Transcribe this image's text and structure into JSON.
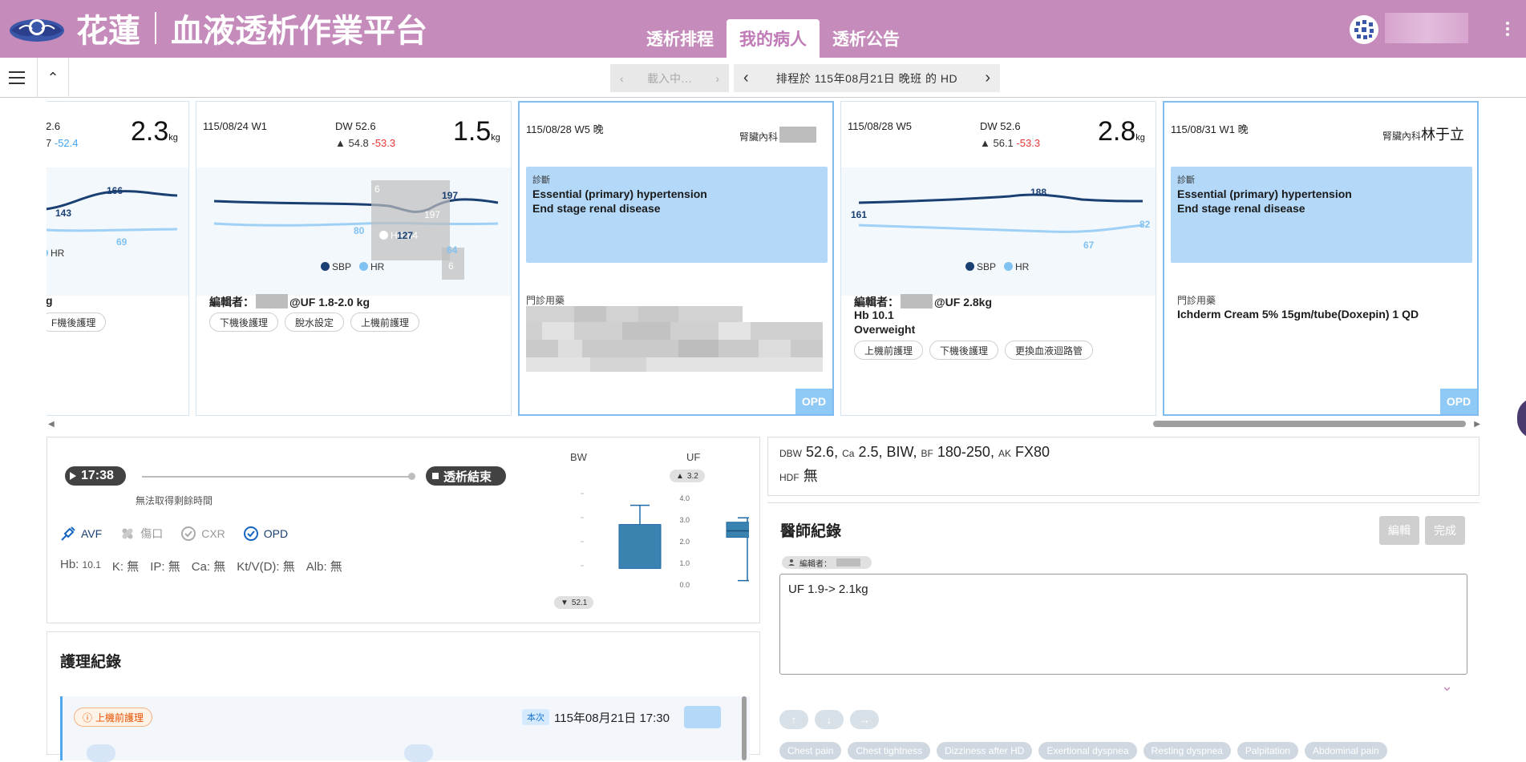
{
  "header": {
    "brand_left": "花蓮",
    "brand_right": "血液透析作業平台",
    "tabs": [
      {
        "label": "透析排程",
        "active": false
      },
      {
        "label": "我的病人",
        "active": true
      },
      {
        "label": "透析公告",
        "active": false
      }
    ],
    "accent_color": "#c48bbb"
  },
  "toolbar": {
    "loading_label": "載入中…",
    "schedule_label": "排程於 115年08月21日 晚班 的 HD"
  },
  "cards": [
    {
      "date": "",
      "dw": "2.6",
      "dw_prev": "7",
      "dw_diff": "-52.4",
      "weight": "2.3",
      "unit": "kg",
      "sbp_label": "166",
      "sbp_left": "143",
      "hr_label": "69",
      "legend_hr": "HR",
      "editor": "g",
      "chip": "F機後護理"
    },
    {
      "date": "115/08/24 W1",
      "dw": "DW 52.6",
      "dw_prev": "54.8",
      "dw_diff": "-53.3",
      "weight": "1.5",
      "unit": "kg",
      "sbp_right": "197",
      "sbp_mid": "127",
      "hr_mid": "80",
      "hr_right": "64",
      "tooltip_sbp": "197",
      "tooltip_hr": "64",
      "tooltip_hr_label": "HR",
      "tooltip_top": "6",
      "tooltip_bottom": "6",
      "legend_sbp": "SBP",
      "legend_hr": "HR",
      "editor_prefix": "編輯者：",
      "editor_suffix": "@UF 1.8-2.0 kg",
      "chips": [
        "下機後護理",
        "脫水設定",
        "上機前護理"
      ]
    },
    {
      "date": "115/08/28 W5 晚",
      "doctor_label": "腎臟內科",
      "diag_label": "診斷",
      "diag_lines": [
        "Essential (primary) hypertension",
        "End stage renal disease"
      ],
      "med_label": "門診用藥",
      "badge": "OPD"
    },
    {
      "date": "115/08/28 W5",
      "dw": "DW 52.6",
      "dw_prev": "56.1",
      "dw_diff": "-53.3",
      "weight": "2.8",
      "unit": "kg",
      "sbp_peak": "188",
      "sbp_left": "161",
      "hr_low": "67",
      "hr_right": "82",
      "legend_sbp": "SBP",
      "legend_hr": "HR",
      "editor_prefix": "編輯者：",
      "editor_suffix": "@UF 2.8kg",
      "extra_lines": [
        "Hb 10.1",
        "Overweight"
      ],
      "chips": [
        "上機前護理",
        "下機後護理",
        "更換血液迴路管"
      ]
    },
    {
      "date": "115/08/31 W1 晚",
      "doctor_label": "腎臟內科",
      "doctor_name": "林于立",
      "diag_label": "診斷",
      "diag_lines": [
        "Essential (primary) hypertension",
        "End stage renal disease"
      ],
      "med_label": "門診用藥",
      "med_text": "Ichderm Cream 5% 15gm/tube(Doxepin) 1 QD",
      "badge": "OPD"
    }
  ],
  "session": {
    "start_time": "17:38",
    "end_label": "透析結束",
    "remaining": "無法取得剩餘時間",
    "status": [
      {
        "icon": "syringe-icon",
        "label": "AVF",
        "active": true
      },
      {
        "icon": "bandage-icon",
        "label": "傷口",
        "active": false
      },
      {
        "icon": "check-circle-icon",
        "label": "CXR",
        "active": false
      },
      {
        "icon": "check-circle-icon",
        "label": "OPD",
        "active": true
      }
    ],
    "labs": {
      "hb_label": "Hb:",
      "hb_value": "10.1",
      "k": "K: 無",
      "ip": "IP: 無",
      "ca": "Ca: 無",
      "ktv": "Kt/V(D): 無",
      "alb": "Alb: 無"
    },
    "bw_title": "BW",
    "uf_title": "UF",
    "uf_top": "3.2",
    "bw_bottom": "52.1",
    "uf_ticks": [
      "4.0",
      "3.0",
      "2.0",
      "1.0",
      "0.0"
    ]
  },
  "chart_data": [
    {
      "type": "box",
      "title": "BW",
      "q1": 51.6,
      "q3": 53.2,
      "whisker_low": 51.6,
      "whisker_high": 53.9,
      "marker": "52.1"
    },
    {
      "type": "box",
      "title": "UF",
      "ylim": [
        0,
        4
      ],
      "ticks": [
        0,
        1,
        2,
        3,
        4
      ],
      "q1": 2.2,
      "median": 2.5,
      "q3": 2.9,
      "whisker_low": 0.2,
      "whisker_high": 3.1,
      "marker": "3.2"
    }
  ],
  "dialysis_info": {
    "dbw_label": "DBW",
    "dbw": "52.6",
    "ca_label": "Ca",
    "ca": "2.5",
    "freq": "BIW",
    "bf_label": "BF",
    "bf": "180-250",
    "ak_label": "AK",
    "ak": "FX80",
    "hdf_label": "HDF",
    "hdf": "無"
  },
  "doctor_record": {
    "title": "醫師紀錄",
    "edit_label": "編輯",
    "done_label": "完成",
    "editor_label": "編輯者：",
    "note": "UF 1.9-> 2.1kg",
    "symptoms": [
      "Chest pain",
      "Chest tightness",
      "Dizziness after HD",
      "Exertional dyspnea",
      "Resting dyspnea",
      "Palpitation",
      "Abdominal pain"
    ]
  },
  "nursing_record": {
    "title": "護理紀錄",
    "entry_type": "上機前護理",
    "this_label": "本次",
    "entry_date": "115年08月21日 17:30"
  }
}
